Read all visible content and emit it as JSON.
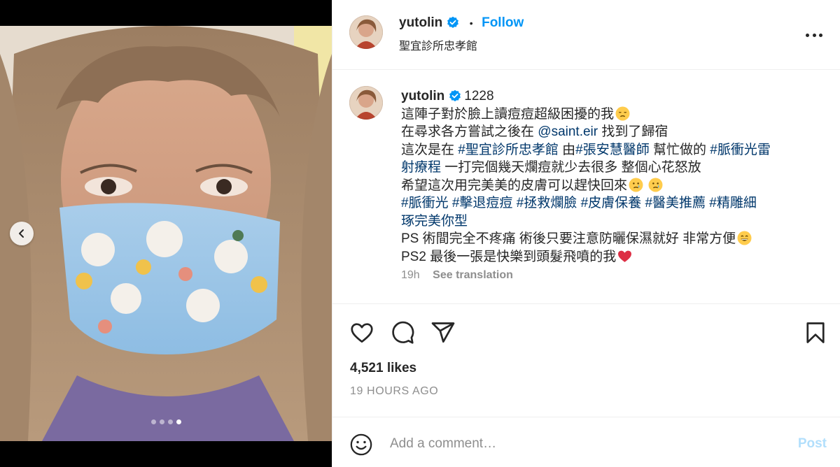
{
  "media": {
    "image_alt": "Selfie of a woman with long hair wearing a floral patterned face mask",
    "carousel_dots": 4,
    "active_dot": 4
  },
  "header": {
    "username": "yutolin",
    "separator": "•",
    "follow_label": "Follow",
    "location": "聖宜診所忠孝館"
  },
  "caption": {
    "username": "yutolin",
    "lines": [
      [
        {
          "t": "1228",
          "k": "text"
        }
      ],
      [
        {
          "t": "這陣子對於臉上讀痘痘超級困擾的我",
          "k": "text"
        },
        {
          "t": "disappointed-face",
          "k": "emoji"
        }
      ],
      [
        {
          "t": "在尋求各方嘗試之後在 ",
          "k": "text"
        },
        {
          "t": "@saint.eir",
          "k": "tag"
        },
        {
          "t": " 找到了歸宿",
          "k": "text"
        }
      ],
      [
        {
          "t": "這次是在 ",
          "k": "text"
        },
        {
          "t": "#聖宜診所忠孝館",
          "k": "tag"
        },
        {
          "t": " 由",
          "k": "text"
        },
        {
          "t": "#張安慧醫師",
          "k": "tag"
        },
        {
          "t": " 幫忙做的 ",
          "k": "text"
        },
        {
          "t": "#脈衝光雷",
          "k": "tag"
        }
      ],
      [
        {
          "t": "射療程",
          "k": "tag"
        },
        {
          "t": " 一打完個幾天爛痘就少去很多 整個心花怒放",
          "k": "text"
        }
      ],
      [
        {
          "t": "希望這次用完美美的皮膚可以趕快回來",
          "k": "text"
        },
        {
          "t": "crying-face",
          "k": "emoji"
        },
        {
          "t": " ",
          "k": "text"
        },
        {
          "t": "crying-face",
          "k": "emoji"
        }
      ],
      [
        {
          "t": "#脈衝光",
          "k": "tag"
        },
        {
          "t": " ",
          "k": "text"
        },
        {
          "t": "#擊退痘痘",
          "k": "tag"
        },
        {
          "t": " ",
          "k": "text"
        },
        {
          "t": "#拯救爛臉",
          "k": "tag"
        },
        {
          "t": " ",
          "k": "text"
        },
        {
          "t": "#皮膚保養",
          "k": "tag"
        },
        {
          "t": " ",
          "k": "text"
        },
        {
          "t": "#醫美推薦",
          "k": "tag"
        },
        {
          "t": " ",
          "k": "text"
        },
        {
          "t": "#精雕細",
          "k": "tag"
        }
      ],
      [
        {
          "t": "琢完美你型",
          "k": "tag"
        }
      ],
      [
        {
          "t": "PS 術間完全不疼痛 術後只要注意防曬保濕就好 非常方便",
          "k": "text"
        },
        {
          "t": "grinning-face",
          "k": "emoji"
        }
      ],
      [
        {
          "t": "PS2 最後一張是快樂到頭髮飛噴的我",
          "k": "text"
        },
        {
          "t": "red-heart",
          "k": "emoji"
        }
      ]
    ],
    "age": "19h",
    "see_translation": "See translation"
  },
  "stats": {
    "likes": "4,521 likes",
    "posted": "19 HOURS AGO"
  },
  "comment": {
    "placeholder": "Add a comment…",
    "post_label": "Post"
  },
  "colors": {
    "accent": "#0095f6",
    "tag": "#00376b",
    "muted": "#8e8e8e",
    "post_disabled": "#b2dffc"
  }
}
